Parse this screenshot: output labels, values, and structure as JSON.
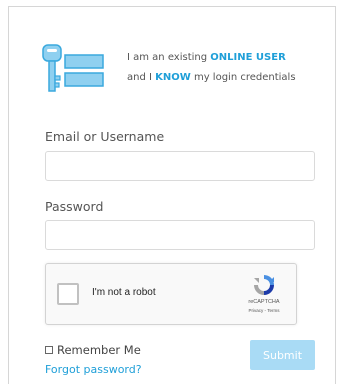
{
  "hero": {
    "line1_prefix": "I am an existing ",
    "line1_emphasis": "ONLINE USER",
    "line2_prefix": "and I ",
    "line2_emphasis": "KNOW",
    "line2_suffix": " my login credentials"
  },
  "form": {
    "username_label": "Email or Username",
    "username_value": "",
    "password_label": "Password",
    "password_value": ""
  },
  "recaptcha": {
    "label": "I'm not a robot",
    "brand": "reCAPTCHA",
    "terms": "Privacy - Terms",
    "checked": false
  },
  "remember": {
    "label": "Remember Me",
    "checked": false
  },
  "forgot_label": "Forgot password?",
  "submit_label": "Submit",
  "colors": {
    "accent": "#1f9fd8",
    "submit_bg": "#a9dbf5",
    "icon_fill": "#8fd0f0"
  }
}
